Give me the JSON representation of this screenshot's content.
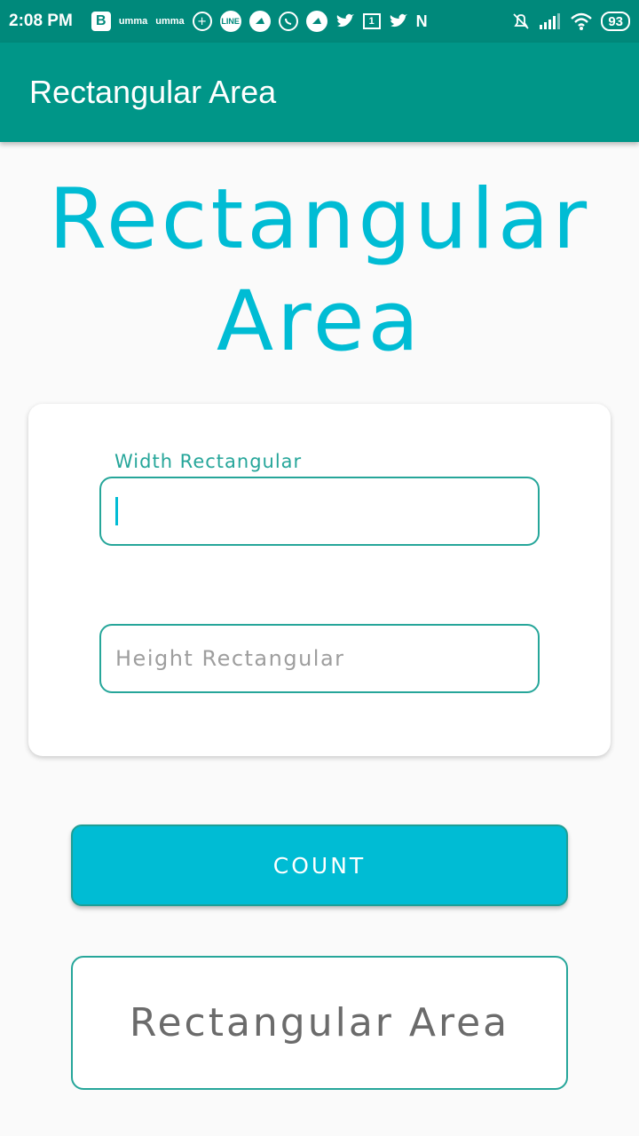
{
  "status_bar": {
    "time": "2:08 PM",
    "b_icon": "B",
    "umma_1": "umma",
    "umma_2": "umma",
    "line_label": "LINE",
    "calendar_day": "1",
    "n_icon": "N",
    "battery": "93"
  },
  "app_bar": {
    "title": "Rectangular Area"
  },
  "hero": {
    "line1": "Rectangular",
    "line2": "Area"
  },
  "form": {
    "width_label": "Width Rectangular",
    "width_value": "",
    "height_placeholder": "Height Rectangular"
  },
  "count_button": {
    "label": "COUNT"
  },
  "result": {
    "text": "Rectangular Area"
  },
  "colors": {
    "status_bar": "#00897b",
    "app_bar": "#009688",
    "accent": "#00bcd4",
    "border": "#26a69a"
  }
}
